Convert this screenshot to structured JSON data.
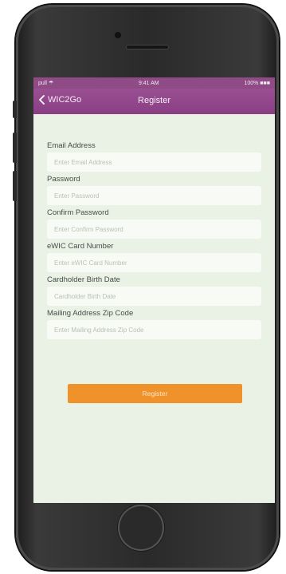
{
  "status_bar": {
    "signal": "pull ☂",
    "time": "9:41 AM",
    "battery": "100% ■■■"
  },
  "nav": {
    "back_label": "WIC2Go",
    "title": "Register"
  },
  "form": {
    "fields": [
      {
        "label": "Email Address",
        "placeholder": "Enter Email Address"
      },
      {
        "label": "Password",
        "placeholder": "Enter Password"
      },
      {
        "label": "Confirm Password",
        "placeholder": "Enter Confirm Password"
      },
      {
        "label": "eWIC Card Number",
        "placeholder": "Enter eWIC Card Number"
      },
      {
        "label": "Cardholder Birth Date",
        "placeholder": "Cardholder Birth Date"
      },
      {
        "label": "Mailing Address Zip Code",
        "placeholder": "Enter Mailing Address Zip Code"
      }
    ],
    "submit_label": "Register"
  },
  "colors": {
    "nav_bg": "#8e4b86",
    "screen_bg": "#e9f2e4",
    "button_bg": "#f0922a"
  }
}
